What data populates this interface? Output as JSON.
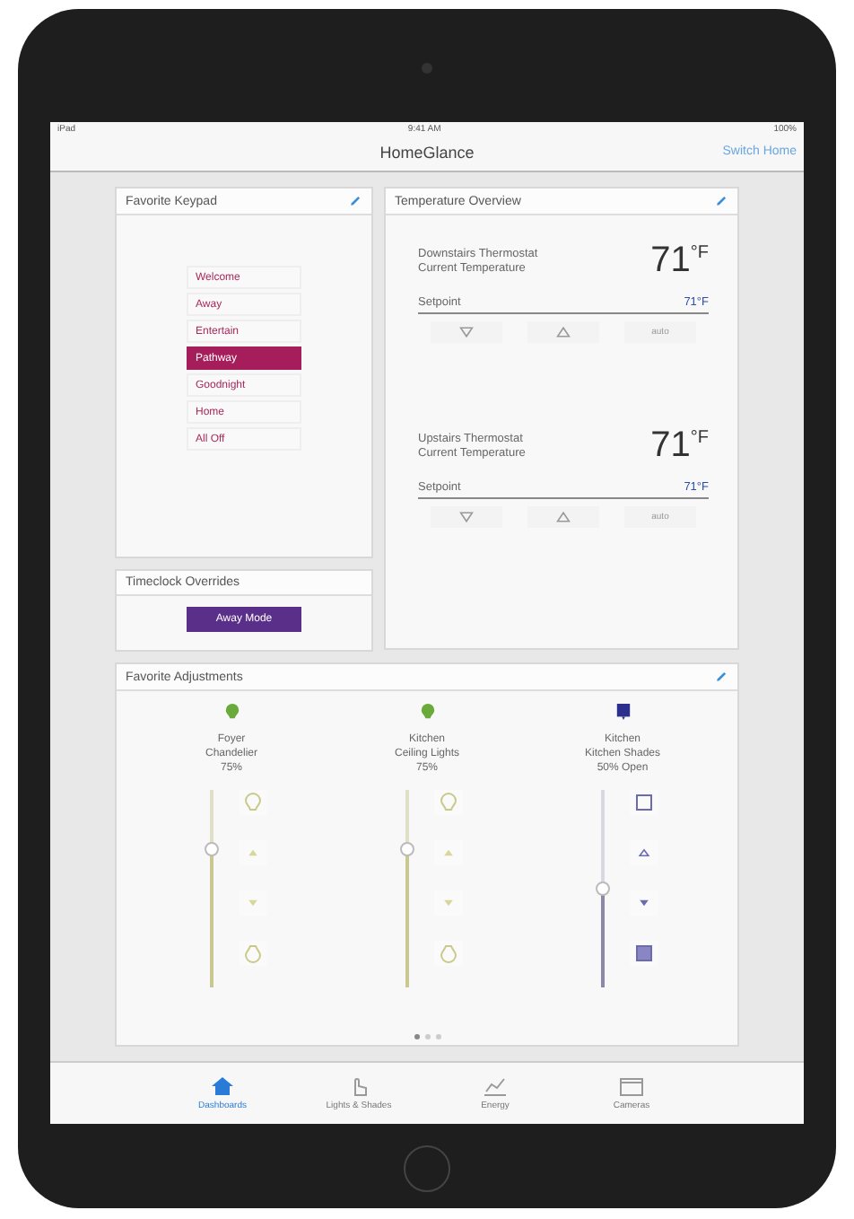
{
  "status_bar": {
    "carrier": "iPad",
    "time": "9:41 AM",
    "battery": "100%"
  },
  "nav": {
    "title": "HomeGlance",
    "action": "Switch Home"
  },
  "keypad": {
    "title": "Favorite Keypad",
    "buttons": [
      {
        "label": "Welcome",
        "selected": false
      },
      {
        "label": "Away",
        "selected": false
      },
      {
        "label": "Entertain",
        "selected": false
      },
      {
        "label": "Pathway",
        "selected": true
      },
      {
        "label": "Goodnight",
        "selected": false
      },
      {
        "label": "Home",
        "selected": false
      },
      {
        "label": "All Off",
        "selected": false
      }
    ]
  },
  "timeclock": {
    "title": "Timeclock Overrides",
    "button": "Away Mode"
  },
  "temperature": {
    "title": "Temperature Overview",
    "thermostats": [
      {
        "name": "Downstairs Thermostat",
        "subtitle": "Current Temperature",
        "value": "71",
        "unit": "°F",
        "setpoint_label": "Setpoint",
        "setpoint": "71°F",
        "mode": "auto"
      },
      {
        "name": "Upstairs Thermostat",
        "subtitle": "Current Temperature",
        "value": "71",
        "unit": "°F",
        "setpoint_label": "Setpoint",
        "setpoint": "71°F",
        "mode": "auto"
      }
    ]
  },
  "adjustments": {
    "title": "Favorite Adjustments",
    "devices": [
      {
        "kind": "light",
        "area": "Foyer",
        "name": "Chandelier",
        "reading": "75%",
        "level": 0.7
      },
      {
        "kind": "light",
        "area": "Kitchen",
        "name": "Ceiling Lights",
        "reading": "75%",
        "level": 0.7
      },
      {
        "kind": "shade",
        "area": "Kitchen",
        "name": "Kitchen Shades",
        "reading": "50% Open",
        "level": 0.5
      }
    ]
  },
  "page_dots": [
    {
      "selected": true
    },
    {
      "selected": false
    },
    {
      "selected": false
    }
  ],
  "tabs": [
    {
      "label": "Dashboards",
      "selected": true
    },
    {
      "label": "Lights & Shades",
      "selected": false
    },
    {
      "label": "Energy",
      "selected": false
    },
    {
      "label": "Cameras",
      "selected": false
    }
  ]
}
